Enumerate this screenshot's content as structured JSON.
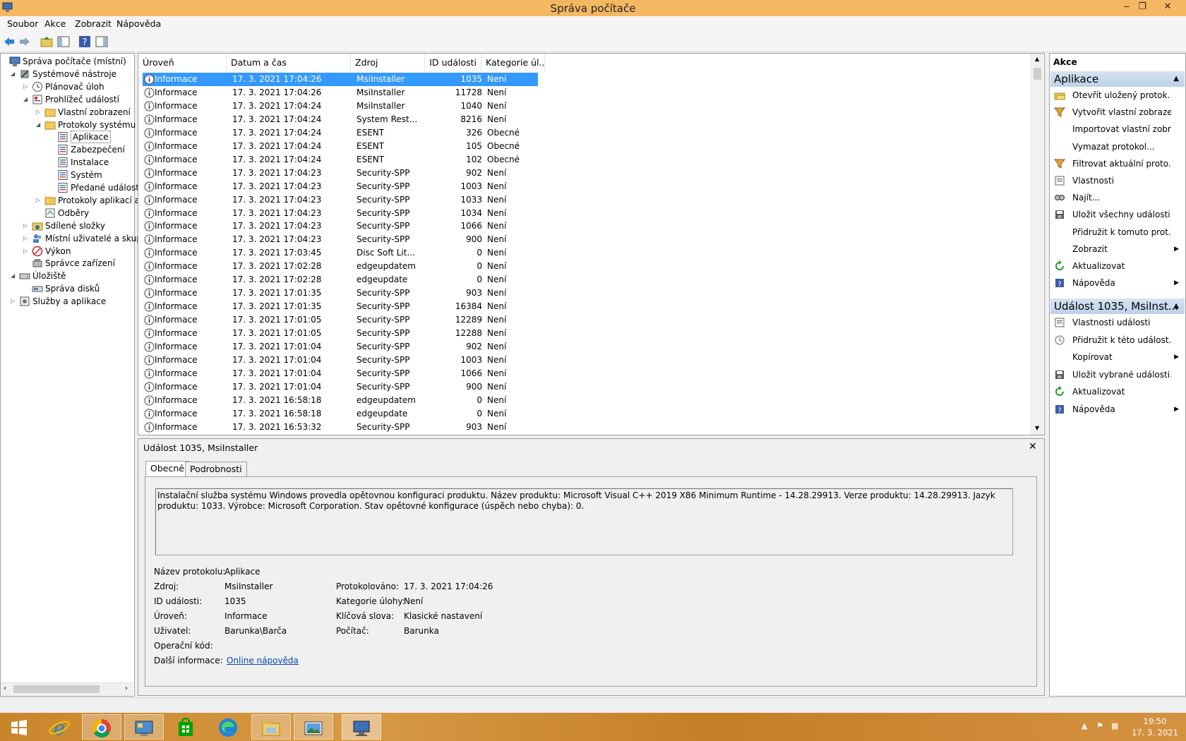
{
  "window": {
    "title": "Správa počítače"
  },
  "menu": [
    "Soubor",
    "Akce",
    "Zobrazit",
    "Nápověda"
  ],
  "tree": [
    {
      "label": "Správa počítače (místní)",
      "level": 0,
      "exp": "",
      "icon": "computer-icon"
    },
    {
      "label": "Systémové nástroje",
      "level": 1,
      "exp": "◢",
      "icon": "tools-icon"
    },
    {
      "label": "Plánovač úloh",
      "level": 2,
      "exp": "▷",
      "icon": "clock-icon"
    },
    {
      "label": "Prohlížeč událostí",
      "level": 2,
      "exp": "◢",
      "icon": "event-viewer-icon"
    },
    {
      "label": "Vlastní zobrazení",
      "level": 3,
      "exp": "▷",
      "icon": "folder-icon"
    },
    {
      "label": "Protokoly systému V",
      "level": 3,
      "exp": "◢",
      "icon": "folder-icon"
    },
    {
      "label": "Aplikace",
      "level": 4,
      "exp": "",
      "icon": "log-icon",
      "selected": true
    },
    {
      "label": "Zabezpečení",
      "level": 4,
      "exp": "",
      "icon": "log-icon"
    },
    {
      "label": "Instalace",
      "level": 4,
      "exp": "",
      "icon": "log-icon"
    },
    {
      "label": "Systém",
      "level": 4,
      "exp": "",
      "icon": "log-icon"
    },
    {
      "label": "Předané události",
      "level": 4,
      "exp": "",
      "icon": "log-icon"
    },
    {
      "label": "Protokoly aplikací a",
      "level": 3,
      "exp": "▷",
      "icon": "folder-icon"
    },
    {
      "label": "Odběry",
      "level": 3,
      "exp": "",
      "icon": "subscription-icon"
    },
    {
      "label": "Sdílené složky",
      "level": 2,
      "exp": "▷",
      "icon": "shared-folder-icon"
    },
    {
      "label": "Místní uživatelé a skupir",
      "level": 2,
      "exp": "▷",
      "icon": "users-icon"
    },
    {
      "label": "Výkon",
      "level": 2,
      "exp": "▷",
      "icon": "performance-icon"
    },
    {
      "label": "Správce zařízení",
      "level": 2,
      "exp": "",
      "icon": "device-manager-icon"
    },
    {
      "label": "Úložiště",
      "level": 1,
      "exp": "◢",
      "icon": "storage-icon"
    },
    {
      "label": "Správa disků",
      "level": 2,
      "exp": "",
      "icon": "disk-icon"
    },
    {
      "label": "Služby a aplikace",
      "level": 1,
      "exp": "▷",
      "icon": "services-icon"
    }
  ],
  "list": {
    "columns": [
      "Úroveň",
      "Datum a čas",
      "Zdroj",
      "ID události",
      "Kategorie úl..."
    ],
    "rows": [
      [
        "Informace",
        "17. 3. 2021 17:04:26",
        "MsiInstaller",
        "1035",
        "Není"
      ],
      [
        "Informace",
        "17. 3. 2021 17:04:26",
        "MsiInstaller",
        "11728",
        "Není"
      ],
      [
        "Informace",
        "17. 3. 2021 17:04:24",
        "MsiInstaller",
        "1040",
        "Není"
      ],
      [
        "Informace",
        "17. 3. 2021 17:04:24",
        "System Rest...",
        "8216",
        "Není"
      ],
      [
        "Informace",
        "17. 3. 2021 17:04:24",
        "ESENT",
        "326",
        "Obecné"
      ],
      [
        "Informace",
        "17. 3. 2021 17:04:24",
        "ESENT",
        "105",
        "Obecné"
      ],
      [
        "Informace",
        "17. 3. 2021 17:04:24",
        "ESENT",
        "102",
        "Obecné"
      ],
      [
        "Informace",
        "17. 3. 2021 17:04:23",
        "Security-SPP",
        "902",
        "Není"
      ],
      [
        "Informace",
        "17. 3. 2021 17:04:23",
        "Security-SPP",
        "1003",
        "Není"
      ],
      [
        "Informace",
        "17. 3. 2021 17:04:23",
        "Security-SPP",
        "1033",
        "Není"
      ],
      [
        "Informace",
        "17. 3. 2021 17:04:23",
        "Security-SPP",
        "1034",
        "Není"
      ],
      [
        "Informace",
        "17. 3. 2021 17:04:23",
        "Security-SPP",
        "1066",
        "Není"
      ],
      [
        "Informace",
        "17. 3. 2021 17:04:23",
        "Security-SPP",
        "900",
        "Není"
      ],
      [
        "Informace",
        "17. 3. 2021 17:03:45",
        "Disc Soft Lit...",
        "0",
        "Není"
      ],
      [
        "Informace",
        "17. 3. 2021 17:02:28",
        "edgeupdatem",
        "0",
        "Není"
      ],
      [
        "Informace",
        "17. 3. 2021 17:02:28",
        "edgeupdate",
        "0",
        "Není"
      ],
      [
        "Informace",
        "17. 3. 2021 17:01:35",
        "Security-SPP",
        "903",
        "Není"
      ],
      [
        "Informace",
        "17. 3. 2021 17:01:35",
        "Security-SPP",
        "16384",
        "Není"
      ],
      [
        "Informace",
        "17. 3. 2021 17:01:05",
        "Security-SPP",
        "12289",
        "Není"
      ],
      [
        "Informace",
        "17. 3. 2021 17:01:05",
        "Security-SPP",
        "12288",
        "Není"
      ],
      [
        "Informace",
        "17. 3. 2021 17:01:04",
        "Security-SPP",
        "902",
        "Není"
      ],
      [
        "Informace",
        "17. 3. 2021 17:01:04",
        "Security-SPP",
        "1003",
        "Není"
      ],
      [
        "Informace",
        "17. 3. 2021 17:01:04",
        "Security-SPP",
        "1066",
        "Není"
      ],
      [
        "Informace",
        "17. 3. 2021 17:01:04",
        "Security-SPP",
        "900",
        "Není"
      ],
      [
        "Informace",
        "17. 3. 2021 16:58:18",
        "edgeupdatem",
        "0",
        "Není"
      ],
      [
        "Informace",
        "17. 3. 2021 16:58:18",
        "edgeupdate",
        "0",
        "Není"
      ],
      [
        "Informace",
        "17. 3. 2021 16:53:32",
        "Security-SPP",
        "903",
        "Není"
      ]
    ]
  },
  "detail": {
    "title": "Událost 1035, MsiInstaller",
    "close": "✕",
    "tabs": [
      "Obecné",
      "Podrobnosti"
    ],
    "description": "Instalační služba systému Windows provedla opětovnou konfiguraci produktu. Název produktu: Microsoft Visual C++ 2019 X86 Minimum Runtime - 14.28.29913. Verze produktu: 14.28.29913. Jazyk produktu: 1033. Výrobce: Microsoft Corporation. Stav opětovné konfigurace (úspěch nebo chyba): 0.",
    "labels": {
      "log": "Název protokolu:",
      "source": "Zdroj:",
      "id": "ID události:",
      "level": "Úroveň:",
      "user": "Uživatel:",
      "opcode": "Operační kód:",
      "more": "Další informace:",
      "logged": "Protokolováno:",
      "category": "Kategorie úlohy:",
      "keywords": "Klíčová slova:",
      "computer": "Počítač:"
    },
    "values": {
      "log": "Aplikace",
      "source": "MsiInstaller",
      "id": "1035",
      "level": "Informace",
      "user": "Barunka\\Barča",
      "more": "Online nápověda",
      "logged": "17. 3. 2021 17:04:26",
      "category": "Není",
      "keywords": "Klasické nastavení",
      "computer": "Barunka"
    }
  },
  "actions": {
    "header": "Akce",
    "section1": "Aplikace",
    "items1": [
      {
        "label": "Otevřít uložený protok...",
        "icon": "open-folder-icon"
      },
      {
        "label": "Vytvořit vlastní zobraze...",
        "icon": "filter-icon"
      },
      {
        "label": "Importovat vlastní zobr...",
        "icon": ""
      },
      {
        "label": "Vymazat protokol...",
        "icon": ""
      },
      {
        "label": "Filtrovat aktuální proto...",
        "icon": "filter-icon"
      },
      {
        "label": "Vlastnosti",
        "icon": "properties-icon"
      },
      {
        "label": "Najít...",
        "icon": "find-icon"
      },
      {
        "label": "Uložit všechny události...",
        "icon": "save-icon"
      },
      {
        "label": "Přidružit k tomuto prot...",
        "icon": ""
      },
      {
        "label": "Zobrazit",
        "icon": "",
        "arrow": true
      },
      {
        "label": "Aktualizovat",
        "icon": "refresh-icon"
      },
      {
        "label": "Nápověda",
        "icon": "help-icon",
        "arrow": true
      }
    ],
    "section2": "Událost 1035, MsiInst...",
    "items2": [
      {
        "label": "Vlastnosti události",
        "icon": "properties-icon"
      },
      {
        "label": "Přidružit k této událost...",
        "icon": "task-icon"
      },
      {
        "label": "Kopírovat",
        "icon": "",
        "arrow": true
      },
      {
        "label": "Uložit vybrané události...",
        "icon": "save-icon"
      },
      {
        "label": "Aktualizovat",
        "icon": "refresh-icon"
      },
      {
        "label": "Nápověda",
        "icon": "help-icon",
        "arrow": true
      }
    ]
  },
  "taskbar": {
    "time": "19:50",
    "date": "17. 3. 2021"
  },
  "colors": {
    "titlebar": "#f4b862",
    "selection": "#3399ff",
    "section": "#c6d9ee",
    "link": "#0645ad"
  }
}
